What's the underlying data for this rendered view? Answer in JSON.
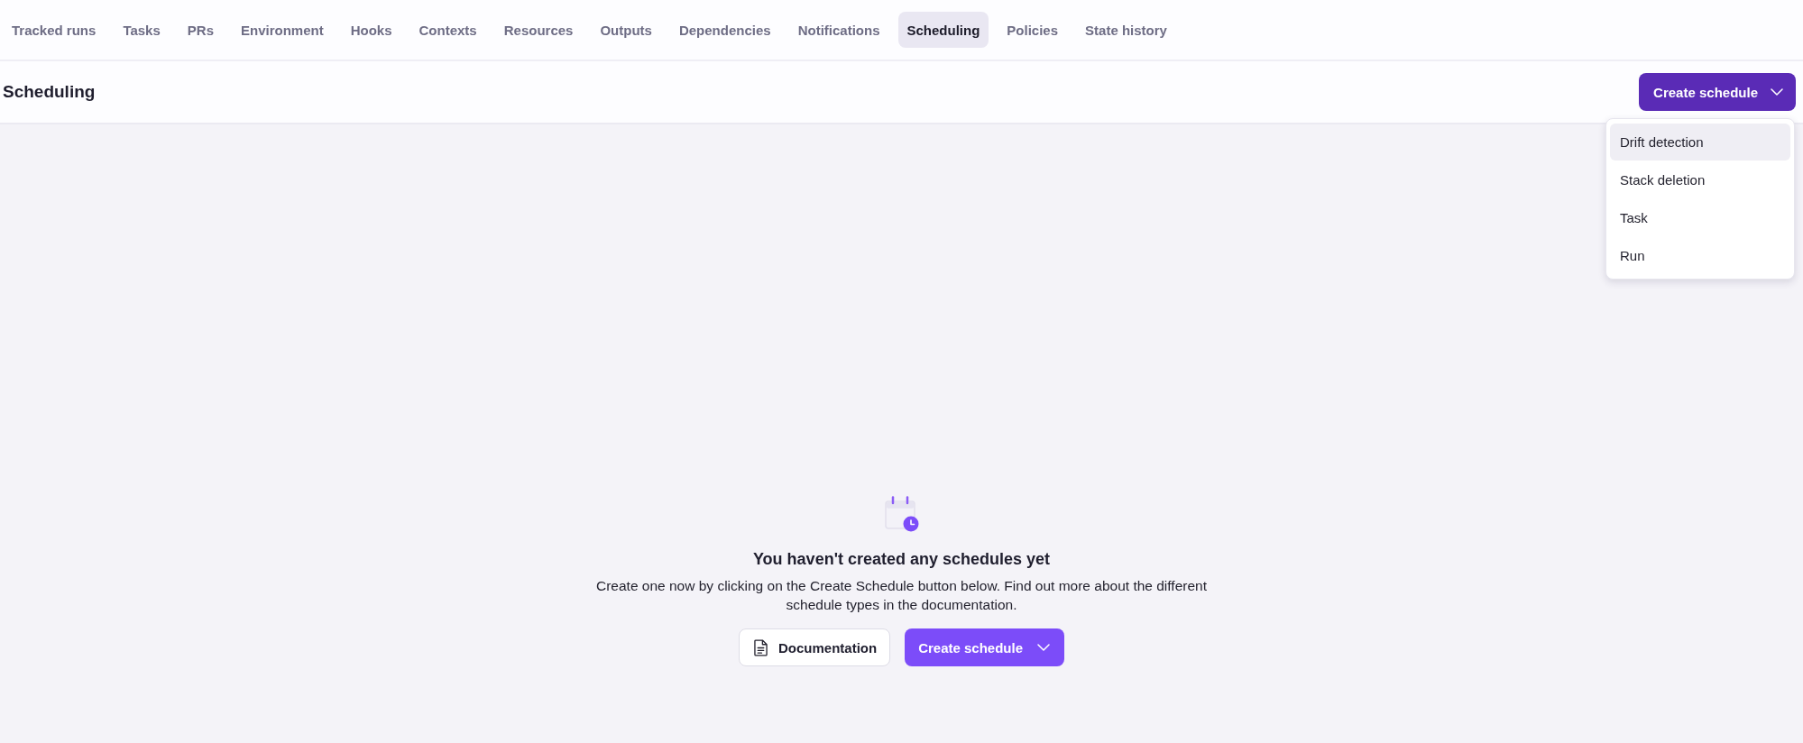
{
  "tabs": [
    {
      "label": "Tracked runs",
      "selected": false
    },
    {
      "label": "Tasks",
      "selected": false
    },
    {
      "label": "PRs",
      "selected": false
    },
    {
      "label": "Environment",
      "selected": false
    },
    {
      "label": "Hooks",
      "selected": false
    },
    {
      "label": "Contexts",
      "selected": false
    },
    {
      "label": "Resources",
      "selected": false
    },
    {
      "label": "Outputs",
      "selected": false
    },
    {
      "label": "Dependencies",
      "selected": false
    },
    {
      "label": "Notifications",
      "selected": false
    },
    {
      "label": "Scheduling",
      "selected": true
    },
    {
      "label": "Policies",
      "selected": false
    },
    {
      "label": "State history",
      "selected": false
    }
  ],
  "header": {
    "title": "Scheduling",
    "create_button": {
      "label": "Create schedule"
    }
  },
  "dropdown": {
    "items": [
      {
        "label": "Drift detection",
        "highlighted": true
      },
      {
        "label": "Stack deletion",
        "highlighted": false
      },
      {
        "label": "Task",
        "highlighted": false
      },
      {
        "label": "Run",
        "highlighted": false
      }
    ]
  },
  "empty_state": {
    "title": "You haven't created any schedules yet",
    "description": "Create one now by clicking on the Create Schedule button below. Find out more about the different schedule types in the documentation.",
    "buttons": [
      {
        "kind": "secondary",
        "label": "Documentation"
      },
      {
        "kind": "primary",
        "label": "Create schedule"
      }
    ]
  }
}
